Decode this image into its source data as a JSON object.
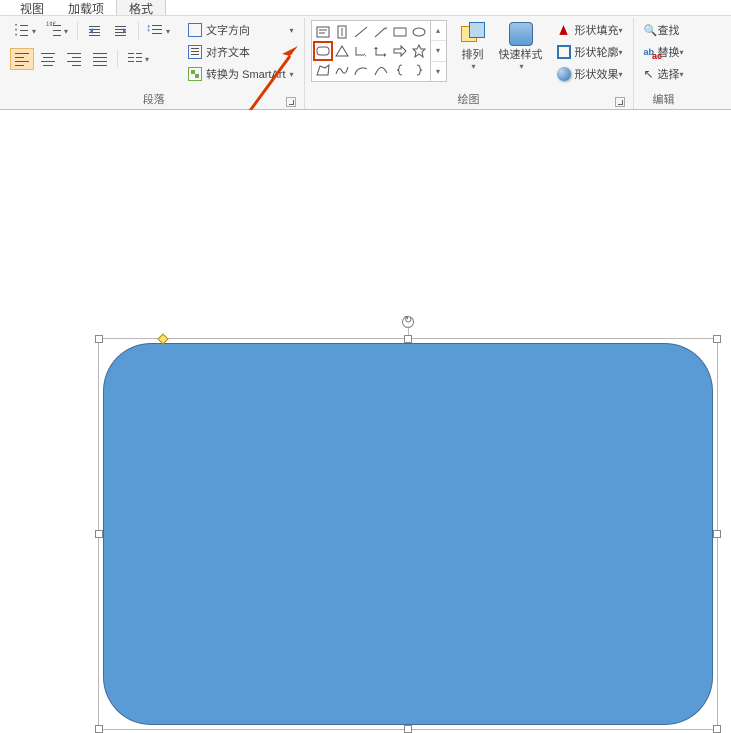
{
  "tabs": {
    "view": "视图",
    "addin": "加载项",
    "format": "格式"
  },
  "paragraph": {
    "group_label": "段落",
    "text_direction": "文字方向",
    "align_text": "对齐文本",
    "convert_smartart": "转换为 SmartArt"
  },
  "drawing": {
    "group_label": "绘图",
    "arrange": "排列",
    "quick_styles": "快速样式",
    "shape_fill": "形状填充",
    "shape_outline": "形状轮廓",
    "shape_effects": "形状效果"
  },
  "editing": {
    "group_label": "编辑",
    "find": "查找",
    "replace": "替换",
    "select": "选择"
  }
}
